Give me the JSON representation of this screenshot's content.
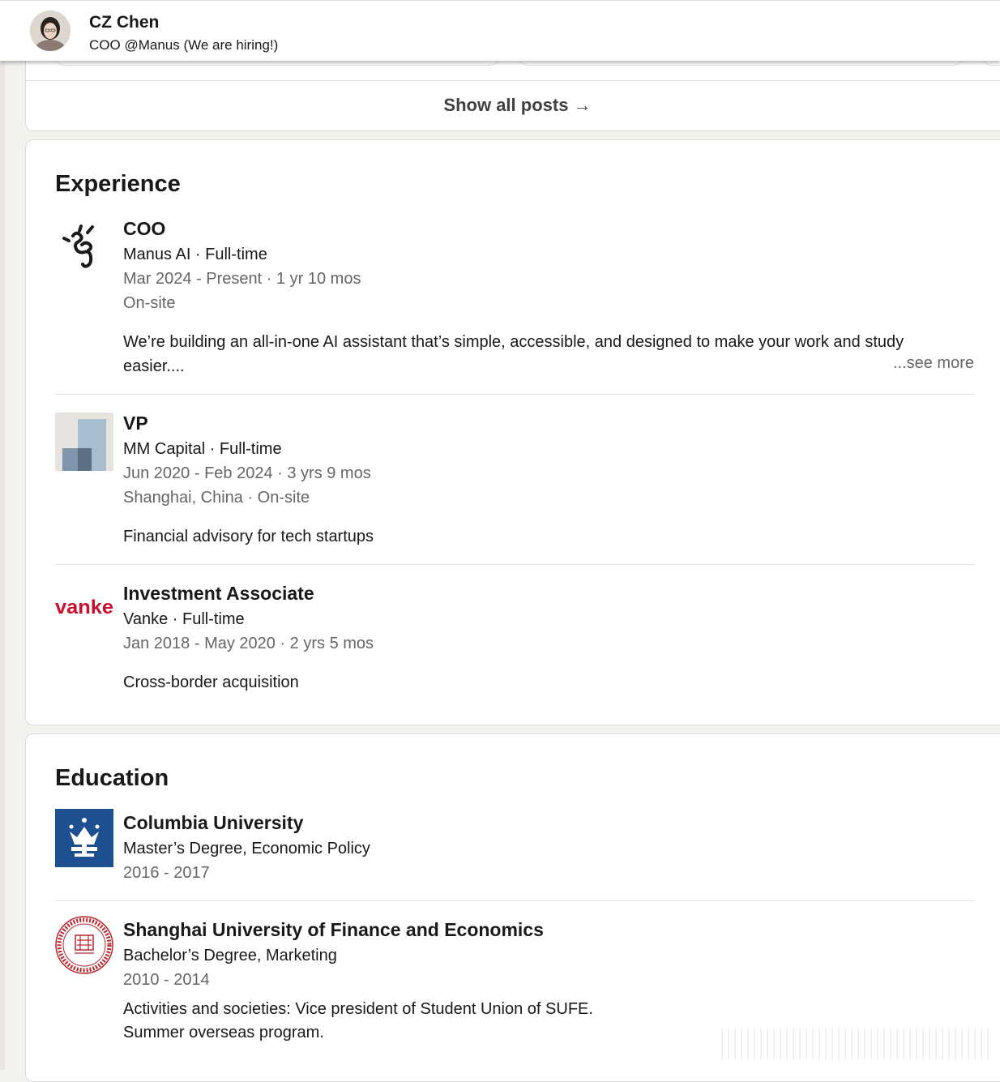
{
  "header": {
    "name": "CZ Chen",
    "headline": "COO @Manus (We are hiring!)"
  },
  "posts": {
    "show_all_label": "Show all posts →"
  },
  "experience": {
    "title": "Experience",
    "items": [
      {
        "role": "COO",
        "company": "Manus AI · Full-time",
        "dates": "Mar 2024 - Present · 1 yr 10 mos",
        "location": "On-site",
        "description": "We’re building an all-in-one AI assistant that’s simple, accessible, and designed to make your work and study easier....",
        "see_more": "...see more",
        "logo_icon": "manus-logo-icon"
      },
      {
        "role": "VP",
        "company": "MM Capital · Full-time",
        "dates": "Jun 2020 - Feb 2024 · 3 yrs 9 mos",
        "location": "Shanghai, China · On-site",
        "description": "Financial advisory for tech startups",
        "logo_icon": "mm-capital-logo-icon"
      },
      {
        "role": "Investment Associate",
        "company": "Vanke · Full-time",
        "dates": "Jan 2018 - May 2020 · 2 yrs 5 mos",
        "description": "Cross-border acquisition",
        "logo_text": "vanke",
        "logo_icon": "vanke-logo-icon",
        "logo_color": "#c8102e"
      }
    ]
  },
  "education": {
    "title": "Education",
    "items": [
      {
        "school": "Columbia University",
        "degree": "Master’s Degree, Economic Policy",
        "dates": "2016 - 2017",
        "logo_icon": "columbia-crown-logo-icon",
        "logo_color": "#1d4f91"
      },
      {
        "school": "Shanghai University of Finance and Economics",
        "degree": "Bachelor’s Degree, Marketing",
        "dates": "2010 - 2014",
        "activities_line1": "Activities and societies: Vice president of Student Union of SUFE.",
        "activities_line2": "Summer overseas program.",
        "logo_icon": "sufe-seal-logo-icon",
        "logo_color": "#b8252d"
      }
    ]
  }
}
